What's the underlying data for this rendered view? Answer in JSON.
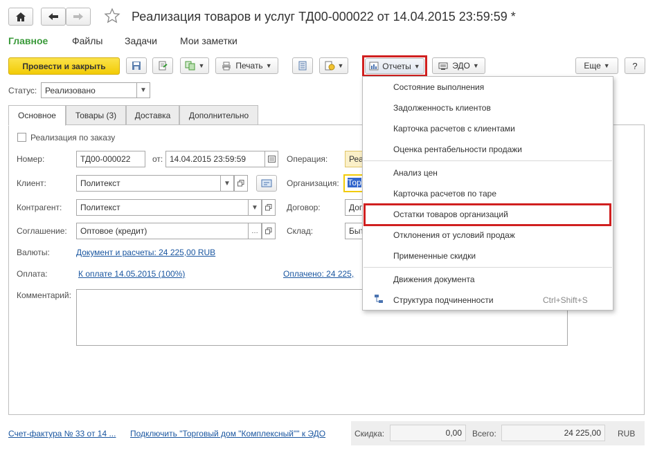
{
  "header": {
    "title": "Реализация товаров и услуг ТД00-000022 от 14.04.2015 23:59:59 *"
  },
  "nav_tabs": [
    "Главное",
    "Файлы",
    "Задачи",
    "Мои заметки"
  ],
  "toolbar": {
    "post_close": "Провести и закрыть",
    "print": "Печать",
    "reports": "Отчеты",
    "edo": "ЭДО",
    "more": "Еще",
    "help": "?"
  },
  "status": {
    "label": "Статус:",
    "value": "Реализовано"
  },
  "form_tabs": [
    "Основное",
    "Товары (3)",
    "Доставка",
    "Дополнительно"
  ],
  "form": {
    "by_order": "Реализация по заказу",
    "number_label": "Номер:",
    "number_value": "ТД00-000022",
    "date_label": "от:",
    "date_value": "14.04.2015 23:59:59",
    "client_label": "Клиент:",
    "client_value": "Политекст",
    "contractor_label": "Контрагент:",
    "contractor_value": "Политекст",
    "agreement_label": "Соглашение:",
    "agreement_value": "Оптовое (кредит)",
    "currency_label": "Валюты:",
    "currency_link": "Документ и расчеты: 24 225,00 RUB",
    "payment_label": "Оплата:",
    "payment_link": "К оплате 14.05.2015 (100%)",
    "paid_link": "Оплачено: 24 225,",
    "comment_label": "Комментарий:",
    "operation_label": "Операция:",
    "operation_value": "Реа",
    "organization_label": "Организация:",
    "organization_value": "Тор",
    "contract_label": "Договор:",
    "contract_value": "Дог",
    "warehouse_label": "Склад:",
    "warehouse_value": "Быт"
  },
  "reports_menu": {
    "items": [
      "Состояние выполнения",
      "Задолженность клиентов",
      "Карточка расчетов с клиентами",
      "Оценка рентабельности продажи",
      "Анализ цен",
      "Карточка расчетов по таре",
      "Остатки товаров организаций",
      "Отклонения от условий продаж",
      "Примененные скидки",
      "Движения документа",
      "Структура подчиненности"
    ],
    "shortcut": "Ctrl+Shift+S",
    "highlighted": "Остатки товаров организаций"
  },
  "footer": {
    "invoice_link": "Счет-фактура № 33 от 14 ...",
    "connect_link": "Подключить \"Торговый дом \"Комплексный\"\" к ЭДО",
    "discount_label": "Скидка:",
    "discount_value": "0,00",
    "total_label": "Всего:",
    "total_value": "24 225,00",
    "currency": "RUB"
  },
  "colors": {
    "accent_yellow": "#f5d40f",
    "link_blue": "#1a56a0",
    "highlight_red": "#d01f1f",
    "nav_green": "#3a9a3a"
  }
}
